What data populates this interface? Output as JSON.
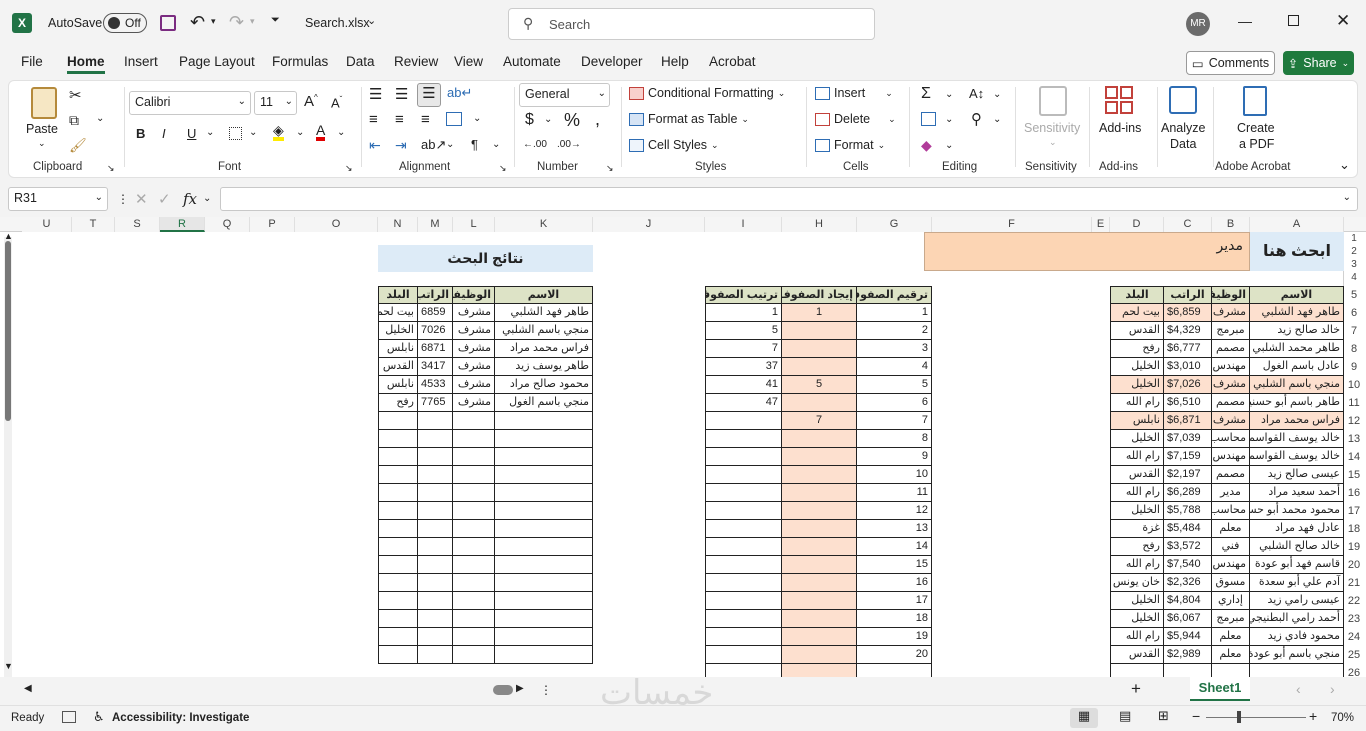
{
  "titlebar": {
    "autosave_label": "AutoSave",
    "autosave_state": "Off",
    "filename": "Search.xlsx",
    "search_placeholder": "Search",
    "user_initials": "MR"
  },
  "tabs": [
    "File",
    "Home",
    "Insert",
    "Page Layout",
    "Formulas",
    "Data",
    "Review",
    "View",
    "Automate",
    "Developer",
    "Help",
    "Acrobat"
  ],
  "active_tab": "Home",
  "buttons": {
    "comments": "Comments",
    "share": "Share"
  },
  "ribbon": {
    "clipboard": {
      "paste": "Paste",
      "group": "Clipboard"
    },
    "font": {
      "name": "Calibri",
      "size": "11",
      "group": "Font"
    },
    "alignment": {
      "group": "Alignment"
    },
    "number": {
      "format": "General",
      "group": "Number"
    },
    "styles": {
      "cond": "Conditional Formatting",
      "table": "Format as Table",
      "cell": "Cell Styles",
      "group": "Styles"
    },
    "cells": {
      "insert": "Insert",
      "delete": "Delete",
      "format": "Format",
      "group": "Cells"
    },
    "editing": {
      "group": "Editing"
    },
    "sensitivity": {
      "label": "Sensitivity",
      "group": "Sensitivity"
    },
    "addins": {
      "label": "Add-ins",
      "group": "Add-ins"
    },
    "analyze": {
      "l1": "Analyze",
      "l2": "Data"
    },
    "pdf": {
      "l1": "Create",
      "l2": "a PDF",
      "group": "Adobe Acrobat"
    }
  },
  "formula_bar": {
    "name_box": "R31",
    "fx": "fx",
    "content": ""
  },
  "columns": [
    "U",
    "T",
    "S",
    "R",
    "Q",
    "P",
    "O",
    "N",
    "M",
    "L",
    "K",
    "J",
    "I",
    "H",
    "G",
    "F",
    "E",
    "D",
    "C",
    "B",
    "A"
  ],
  "rows": [
    "1",
    "2",
    "3",
    "4",
    "5",
    "6",
    "7",
    "8",
    "9",
    "10",
    "11",
    "12",
    "13",
    "14",
    "15",
    "16",
    "17",
    "18",
    "19",
    "20",
    "21",
    "22",
    "23",
    "24",
    "25",
    "26"
  ],
  "search": {
    "label": "ابحث هنا",
    "value": "مدير"
  },
  "results": {
    "title": "نتائج البحث",
    "headers": [
      "الاسم",
      "الوظيفة",
      "الراتب",
      "البلد"
    ],
    "rows": [
      [
        "طاهر فهد الشلبي",
        "مشرف",
        "6859",
        "بيت لحم"
      ],
      [
        "منجي باسم الشلبي",
        "مشرف",
        "7026",
        "الخليل"
      ],
      [
        "فراس محمد مراد",
        "مشرف",
        "6871",
        "نابلس"
      ],
      [
        "طاهر يوسف زيد",
        "مشرف",
        "3417",
        "القدس"
      ],
      [
        "محمود صالح مراد",
        "مشرف",
        "4533",
        "نابلس"
      ],
      [
        "منجي باسم الغول",
        "مشرف",
        "7765",
        "رفح"
      ]
    ]
  },
  "helper": {
    "headers": [
      "ترقيم الصفوف",
      "إيجاد الصفوف",
      "ترتيب الصفوف"
    ],
    "g": [
      "1",
      "2",
      "3",
      "4",
      "5",
      "6",
      "7",
      "8",
      "9",
      "10",
      "11",
      "12",
      "13",
      "14",
      "15",
      "16",
      "17",
      "18",
      "19",
      "20"
    ],
    "h": [
      "1",
      "",
      "",
      "",
      "5",
      "",
      "7",
      "",
      "",
      "",
      "",
      "",
      "",
      "",
      "",
      "",
      "",
      "",
      "",
      ""
    ],
    "i": [
      "1",
      "5",
      "7",
      "37",
      "41",
      "47"
    ]
  },
  "source": {
    "headers": [
      "الاسم",
      "الوظيفة",
      "الراتب",
      "البلد"
    ],
    "rows": [
      [
        "طاهر فهد الشلبي",
        "مشرف",
        "$6,859",
        "بيت لحم"
      ],
      [
        "خالد صالح زيد",
        "مبرمج",
        "$4,329",
        "القدس"
      ],
      [
        "طاهر محمد الشلبي",
        "مصمم",
        "$6,777",
        "رفح"
      ],
      [
        "عادل باسم الغول",
        "مهندس",
        "$3,010",
        "الخليل"
      ],
      [
        "منجي باسم الشلبي",
        "مشرف",
        "$7,026",
        "الخليل"
      ],
      [
        "طاهر باسم أبو حسنين",
        "مصمم",
        "$6,510",
        "رام الله"
      ],
      [
        "فراس محمد مراد",
        "مشرف",
        "$6,871",
        "نابلس"
      ],
      [
        "خالد يوسف القواسمي",
        "محاسب",
        "$7,039",
        "الخليل"
      ],
      [
        "خالد يوسف القواسمي",
        "مهندس",
        "$7,159",
        "رام الله"
      ],
      [
        "عيسى صالح زيد",
        "مصمم",
        "$2,197",
        "القدس"
      ],
      [
        "أحمد سعيد مراد",
        "مدير",
        "$6,289",
        "رام الله"
      ],
      [
        "محمود محمد أبو حسنين",
        "محاسب",
        "$5,788",
        "الخليل"
      ],
      [
        "عادل فهد مراد",
        "معلم",
        "$5,484",
        "غزة"
      ],
      [
        "خالد صالح الشلبي",
        "فني",
        "$3,572",
        "رفح"
      ],
      [
        "قاسم فهد أبو عودة",
        "مهندس",
        "$7,540",
        "رام الله"
      ],
      [
        "آدم علي أبو سعدة",
        "مسوق",
        "$2,326",
        "خان يونس"
      ],
      [
        "عيسى رامي زيد",
        "إداري",
        "$4,804",
        "الخليل"
      ],
      [
        "أحمد رامي البطنيجي",
        "مبرمج",
        "$6,067",
        "الخليل"
      ],
      [
        "محمود فادي زيد",
        "معلم",
        "$5,944",
        "رام الله"
      ],
      [
        "منجي باسم أبو عودة",
        "معلم",
        "$2,989",
        "القدس"
      ]
    ],
    "highlight_rows": [
      0,
      4,
      6
    ]
  },
  "sheet_tab": "Sheet1",
  "status": {
    "ready": "Ready",
    "accessibility": "Accessibility: Investigate",
    "zoom": "70%"
  },
  "watermark": "خمسات",
  "colors": {
    "excel_green": "#217346",
    "header_fill": "#dde3c6",
    "highlight": "#fde0cf",
    "search_fill": "#fcd5b4",
    "label_fill": "#ddebf7",
    "share": "#1f7a3d"
  }
}
